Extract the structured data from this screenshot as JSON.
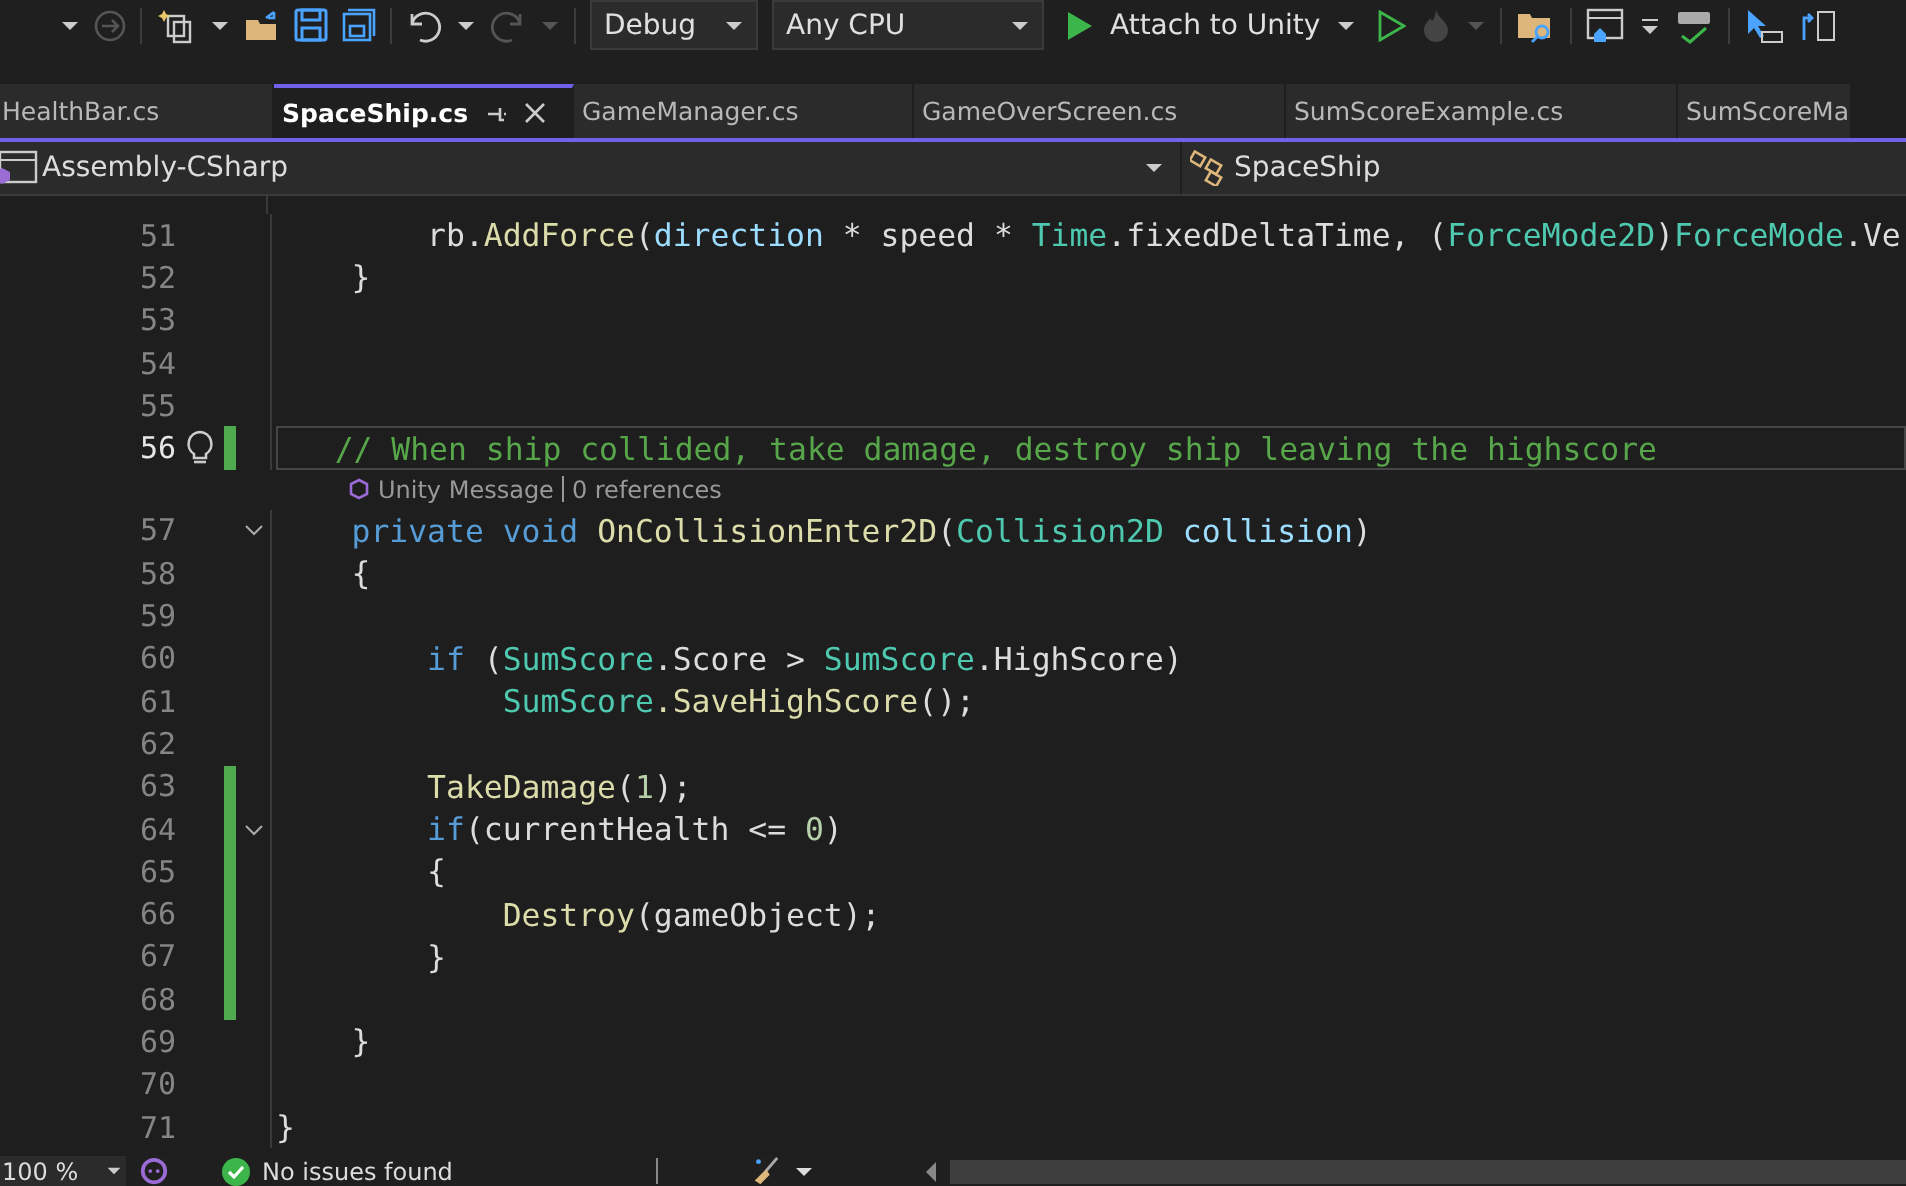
{
  "toolbar": {
    "configuration": "Debug",
    "platform": "Any CPU",
    "run_target": "Attach to Unity"
  },
  "tabs": [
    {
      "label": "HealthBar.cs",
      "selected": false
    },
    {
      "label": "SpaceShip.cs",
      "selected": true
    },
    {
      "label": "GameManager.cs",
      "selected": false
    },
    {
      "label": "GameOverScreen.cs",
      "selected": false
    },
    {
      "label": "SumScoreExample.cs",
      "selected": false
    },
    {
      "label": "SumScoreMa",
      "selected": false
    }
  ],
  "navigation_bar": {
    "project": "Assembly-CSharp",
    "class": "SpaceShip"
  },
  "code_lines": [
    {
      "number": "51",
      "changed": false,
      "current": false,
      "foldable": false,
      "tokens": [
        {
          "text": "        rb.",
          "kind": "plain"
        },
        {
          "text": "AddForce",
          "kind": "method"
        },
        {
          "text": "(",
          "kind": "plain"
        },
        {
          "text": "direction",
          "kind": "param"
        },
        {
          "text": " * speed * ",
          "kind": "plain"
        },
        {
          "text": "Time",
          "kind": "type"
        },
        {
          "text": ".fixedDeltaTime, (",
          "kind": "plain"
        },
        {
          "text": "ForceMode2D",
          "kind": "type"
        },
        {
          "text": ")",
          "kind": "plain"
        },
        {
          "text": "ForceMode",
          "kind": "type"
        },
        {
          "text": ".Ve",
          "kind": "plain"
        }
      ]
    },
    {
      "number": "52",
      "changed": false,
      "current": false,
      "foldable": false,
      "tokens": [
        {
          "text": "    }",
          "kind": "plain"
        }
      ]
    },
    {
      "number": "53",
      "changed": false,
      "current": false,
      "foldable": false
    },
    {
      "number": "54",
      "changed": false,
      "current": false,
      "foldable": false
    },
    {
      "number": "55",
      "changed": false,
      "current": false,
      "foldable": false
    },
    {
      "number": "56",
      "changed": true,
      "current": true,
      "foldable": false,
      "tokens": [
        {
          "text": "   // When ship collided, take damage, destroy ship leaving the highscore",
          "kind": "comment"
        }
      ],
      "codelens": {
        "kind_label": "Unity Message",
        "references": "0 references"
      }
    },
    {
      "number": "57",
      "changed": false,
      "current": false,
      "foldable": true,
      "tokens": [
        {
          "text": "    private void ",
          "kind": "kw"
        },
        {
          "text": "OnCollisionEnter2D",
          "kind": "method"
        },
        {
          "text": "(",
          "kind": "plain"
        },
        {
          "text": "Collision2D",
          "kind": "type"
        },
        {
          "text": " collision",
          "kind": "param"
        },
        {
          "text": ")",
          "kind": "plain"
        }
      ]
    },
    {
      "number": "58",
      "changed": false,
      "current": false,
      "foldable": false,
      "tokens": [
        {
          "text": "    {",
          "kind": "plain"
        }
      ]
    },
    {
      "number": "59",
      "changed": false,
      "current": false,
      "foldable": false
    },
    {
      "number": "60",
      "changed": false,
      "current": false,
      "foldable": false,
      "tokens": [
        {
          "text": "        if",
          "kind": "kw"
        },
        {
          "text": " (",
          "kind": "plain"
        },
        {
          "text": "SumScore",
          "kind": "type"
        },
        {
          "text": ".Score > ",
          "kind": "plain"
        },
        {
          "text": "SumScore",
          "kind": "type"
        },
        {
          "text": ".HighScore)",
          "kind": "plain"
        }
      ]
    },
    {
      "number": "61",
      "changed": false,
      "current": false,
      "foldable": false,
      "tokens": [
        {
          "text": "            SumScore",
          "kind": "type"
        },
        {
          "text": ".SaveHighScore",
          "kind": "method"
        },
        {
          "text": "();",
          "kind": "plain"
        }
      ]
    },
    {
      "number": "62",
      "changed": false,
      "current": false,
      "foldable": false
    },
    {
      "number": "63",
      "changed": true,
      "current": false,
      "foldable": false,
      "tokens": [
        {
          "text": "        TakeDamage",
          "kind": "method"
        },
        {
          "text": "(",
          "kind": "plain"
        },
        {
          "text": "1",
          "kind": "num"
        },
        {
          "text": ");",
          "kind": "plain"
        }
      ]
    },
    {
      "number": "64",
      "changed": true,
      "current": false,
      "foldable": true,
      "tokens": [
        {
          "text": "        if",
          "kind": "kw"
        },
        {
          "text": "(currentHealth <= ",
          "kind": "plain"
        },
        {
          "text": "0",
          "kind": "num"
        },
        {
          "text": ")",
          "kind": "plain"
        }
      ]
    },
    {
      "number": "65",
      "changed": true,
      "current": false,
      "foldable": false,
      "tokens": [
        {
          "text": "        {",
          "kind": "plain"
        }
      ]
    },
    {
      "number": "66",
      "changed": true,
      "current": false,
      "foldable": false,
      "tokens": [
        {
          "text": "            Destroy",
          "kind": "method"
        },
        {
          "text": "(gameObject);",
          "kind": "plain"
        }
      ]
    },
    {
      "number": "67",
      "changed": true,
      "current": false,
      "foldable": false,
      "tokens": [
        {
          "text": "        }",
          "kind": "plain"
        }
      ]
    },
    {
      "number": "68",
      "changed": true,
      "current": false,
      "foldable": false
    },
    {
      "number": "69",
      "changed": false,
      "current": false,
      "foldable": false,
      "tokens": [
        {
          "text": "    }",
          "kind": "plain"
        }
      ]
    },
    {
      "number": "70",
      "changed": false,
      "current": false,
      "foldable": false
    },
    {
      "number": "71",
      "changed": false,
      "current": false,
      "foldable": false,
      "tokens": [
        {
          "text": "}",
          "kind": "plain"
        }
      ]
    }
  ],
  "status_bar": {
    "zoom": "100 %",
    "issues": "No issues found"
  }
}
